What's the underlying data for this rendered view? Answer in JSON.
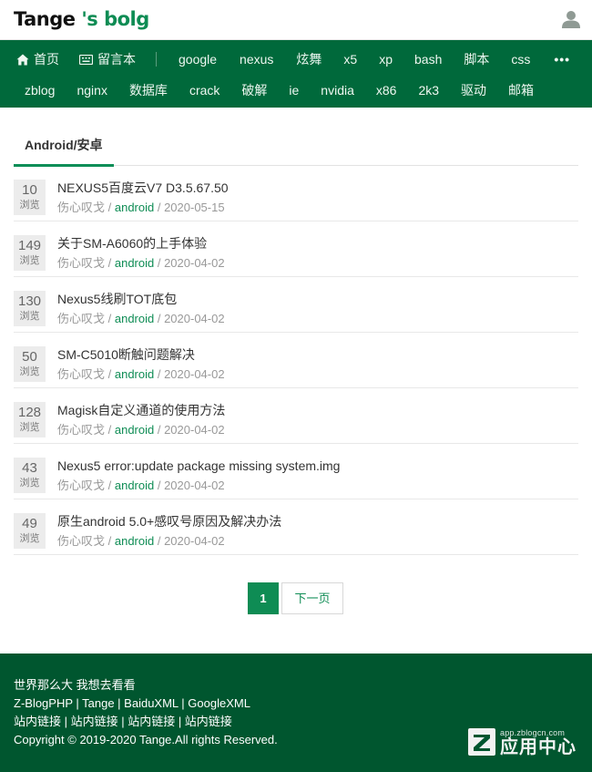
{
  "site": {
    "logo_part1": "Tange",
    "logo_part2": " 's bolg"
  },
  "nav": {
    "row1": [
      {
        "label": "首页",
        "icon": "home-icon"
      },
      {
        "label": "留言本",
        "icon": "keyboard-icon"
      },
      {
        "label": "google"
      },
      {
        "label": "nexus"
      },
      {
        "label": "炫舞"
      },
      {
        "label": "x5"
      },
      {
        "label": "xp"
      },
      {
        "label": "bash"
      },
      {
        "label": "脚本"
      },
      {
        "label": "css"
      },
      {
        "label": "•••"
      }
    ],
    "row2": [
      {
        "label": "zblog"
      },
      {
        "label": "nginx"
      },
      {
        "label": "数据库"
      },
      {
        "label": "crack"
      },
      {
        "label": "破解"
      },
      {
        "label": "ie"
      },
      {
        "label": "nvidia"
      },
      {
        "label": "x86"
      },
      {
        "label": "2k3"
      },
      {
        "label": "驱动"
      },
      {
        "label": "邮箱"
      }
    ]
  },
  "category": {
    "title": "Android/安卓"
  },
  "posts": [
    {
      "views": "10",
      "views_label": "浏览",
      "title": "NEXUS5百度云V7 D3.5.67.50",
      "author": "伤心叹戈",
      "sep1": " / ",
      "category": "android",
      "sep2": " / ",
      "date": "2020-05-15"
    },
    {
      "views": "149",
      "views_label": "浏览",
      "title": "关于SM-A6060的上手体验",
      "author": "伤心叹戈",
      "sep1": " / ",
      "category": "android",
      "sep2": " / ",
      "date": "2020-04-02"
    },
    {
      "views": "130",
      "views_label": "浏览",
      "title": "Nexus5线刷TOT底包",
      "author": "伤心叹戈",
      "sep1": " / ",
      "category": "android",
      "sep2": " / ",
      "date": "2020-04-02"
    },
    {
      "views": "50",
      "views_label": "浏览",
      "title": "SM-C5010断触问题解决",
      "author": "伤心叹戈",
      "sep1": " / ",
      "category": "android",
      "sep2": " / ",
      "date": "2020-04-02"
    },
    {
      "views": "128",
      "views_label": "浏览",
      "title": "Magisk自定义通道的使用方法",
      "author": "伤心叹戈",
      "sep1": " / ",
      "category": "android",
      "sep2": " / ",
      "date": "2020-04-02"
    },
    {
      "views": "43",
      "views_label": "浏览",
      "title": "Nexus5 error:update package missing system.img",
      "author": "伤心叹戈",
      "sep1": " / ",
      "category": "android",
      "sep2": " / ",
      "date": "2020-04-02"
    },
    {
      "views": "49",
      "views_label": "浏览",
      "title": "原生android 5.0+感叹号原因及解决办法",
      "author": "伤心叹戈",
      "sep1": " / ",
      "category": "android",
      "sep2": " / ",
      "date": "2020-04-02"
    }
  ],
  "pagination": {
    "current": "1",
    "next_label": "下一页"
  },
  "footer": {
    "line1": "世界那么大 我想去看看",
    "line2": "Z-BlogPHP | Tange | BaiduXML | GoogleXML",
    "line3": "站内链接 | 站内链接 | 站内链接 | 站内链接",
    "line4": "Copyright © 2019-2020 Tange.All rights Reserved."
  },
  "watermark": {
    "url": "app.zblogcn.com",
    "name": "应用中心"
  },
  "colors": {
    "brand_green": "#00693b",
    "accent_green": "#0e8c54",
    "footer_green": "#00562f"
  }
}
